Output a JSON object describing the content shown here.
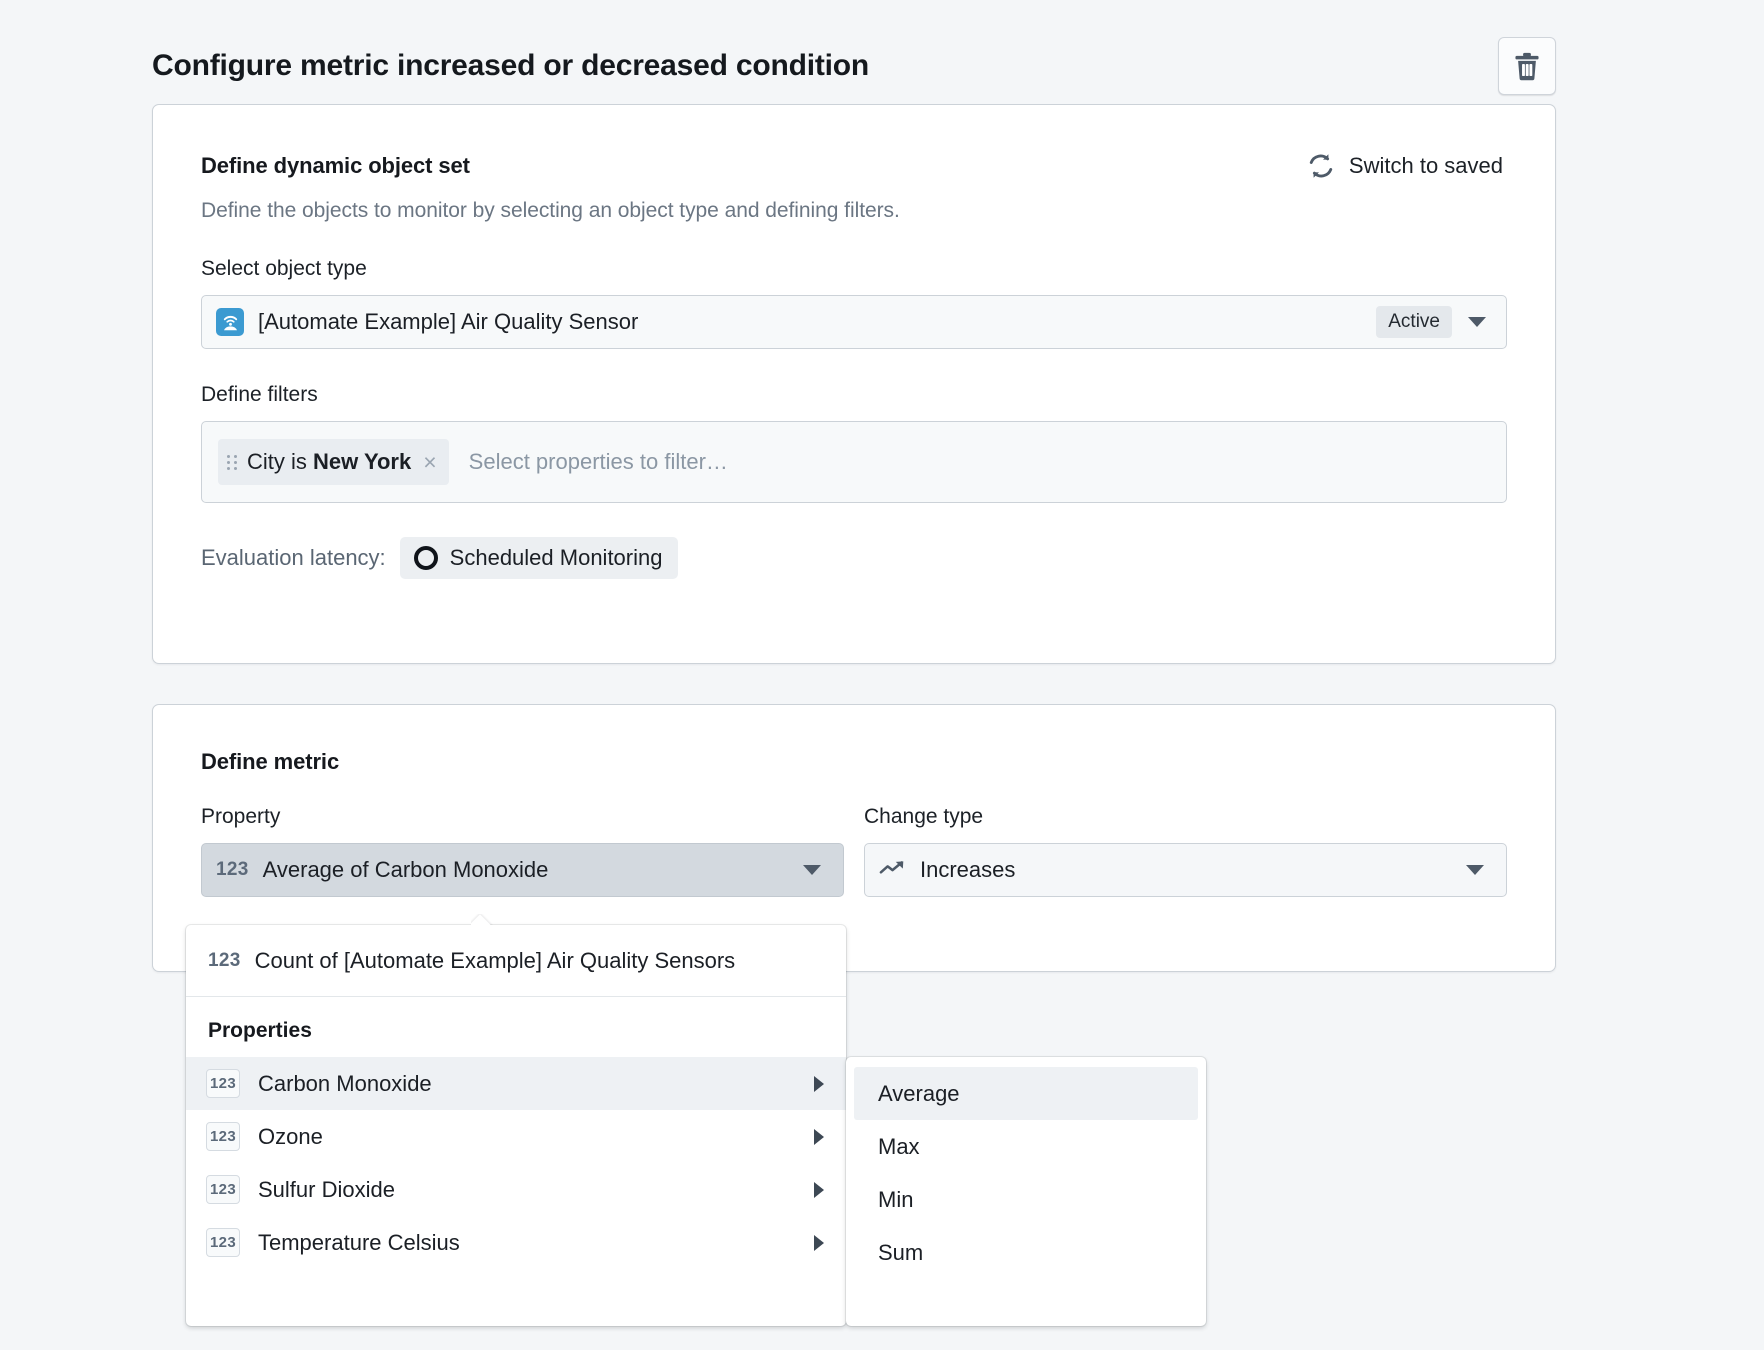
{
  "header": {
    "title": "Configure metric increased or decreased condition",
    "delete_icon": "trash-icon"
  },
  "object_set_card": {
    "title": "Define dynamic object set",
    "switch_label": "Switch to saved",
    "switch_icon": "refresh-sync-icon",
    "description": "Define the objects to monitor by selecting an object type and defining filters.",
    "object_type_label": "Select object type",
    "object_type": {
      "icon": "air-quality-sensor-icon",
      "name": "[Automate Example] Air Quality Sensor",
      "status": "Active",
      "caret_icon": "chevron-down-icon"
    },
    "filters_label": "Define filters",
    "filter_chip": {
      "grip_icon": "drag-handle-icon",
      "prefix": "City is ",
      "value": "New York",
      "remove_icon": "close-icon",
      "remove_glyph": "×"
    },
    "filter_placeholder": "Select properties to filter…",
    "evaluation": {
      "label": "Evaluation latency:",
      "badge_icon": "clock-circle-icon",
      "badge_text": "Scheduled Monitoring"
    }
  },
  "metric_card": {
    "title": "Define metric",
    "property": {
      "label": "Property",
      "num_tag": "123",
      "value": "Average of Carbon Monoxide",
      "caret_icon": "chevron-down-icon"
    },
    "change_type": {
      "label": "Change type",
      "icon": "trending-up-icon",
      "value": "Increases",
      "caret_icon": "chevron-down-icon"
    }
  },
  "property_menu": {
    "count_item": {
      "num_tag": "123",
      "label": "Count of [Automate Example] Air Quality Sensors"
    },
    "section_title": "Properties",
    "items": [
      {
        "num_tag": "123",
        "label": "Carbon Monoxide",
        "selected": true
      },
      {
        "num_tag": "123",
        "label": "Ozone",
        "selected": false
      },
      {
        "num_tag": "123",
        "label": "Sulfur Dioxide",
        "selected": false
      },
      {
        "num_tag": "123",
        "label": "Temperature Celsius",
        "selected": false
      }
    ]
  },
  "aggregation_menu": {
    "items": [
      "Average",
      "Max",
      "Min",
      "Sum"
    ],
    "selected": "Average"
  },
  "colors": {
    "page_background": "#f4f6f8",
    "card_background": "#ffffff",
    "card_border": "#ccd2d8",
    "accent_blue": "#3b9ad1",
    "muted_text": "#6b7683",
    "selected_row": "#eef1f4",
    "active_control": "#d3d9df"
  }
}
